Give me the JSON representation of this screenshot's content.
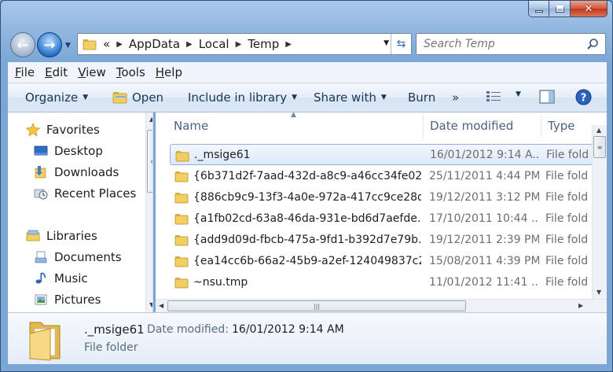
{
  "address": {
    "crumbs": [
      "«",
      "AppData",
      "Local",
      "Temp"
    ]
  },
  "search": {
    "placeholder": "Search Temp"
  },
  "menu": {
    "items": [
      {
        "key": "F",
        "rest": "ile"
      },
      {
        "key": "E",
        "rest": "dit"
      },
      {
        "key": "V",
        "rest": "iew"
      },
      {
        "key": "T",
        "rest": "ools"
      },
      {
        "key": "H",
        "rest": "elp"
      }
    ]
  },
  "toolbar": {
    "organize": "Organize",
    "open": "Open",
    "include": "Include in library",
    "share": "Share with",
    "burn": "Burn",
    "more": "»"
  },
  "nav": {
    "favorites": "Favorites",
    "desktop": "Desktop",
    "downloads": "Downloads",
    "recent": "Recent Places",
    "libraries": "Libraries",
    "documents": "Documents",
    "music": "Music",
    "pictures": "Pictures"
  },
  "columns": {
    "name": "Name",
    "date": "Date modified",
    "type": "Type"
  },
  "files": [
    {
      "name": "._msige61",
      "date": "16/01/2012 9:14 A...",
      "type": "File fold"
    },
    {
      "name": "{6b371d2f-7aad-432d-a8c9-a46cc34fe02...",
      "date": "25/11/2011 4:44 PM",
      "type": "File fold"
    },
    {
      "name": "{886cb9c9-13f3-4a0e-972a-417cc9ce28d...",
      "date": "19/12/2011 3:12 PM",
      "type": "File fold"
    },
    {
      "name": "{a1fb02cd-63a8-46da-931e-bd6d7aefde...",
      "date": "17/10/2011 10:44 ...",
      "type": "File fold"
    },
    {
      "name": "{add9d09d-fbcb-475a-9fd1-b392d7e79b...",
      "date": "19/12/2011 2:39 PM",
      "type": "File fold"
    },
    {
      "name": "{ea14cc6b-66a2-45b9-a2ef-124049837c2...",
      "date": "15/08/2011 4:39 PM",
      "type": "File fold"
    },
    {
      "name": "~nsu.tmp",
      "date": "11/01/2012 11:41 ...",
      "type": "File fold"
    }
  ],
  "details": {
    "name": "._msige61",
    "label": "Date modified:",
    "value": "16/01/2012 9:14 AM",
    "type": "File folder"
  },
  "colors": {
    "accent": "#3a6cb0",
    "selection": "#dce9f8"
  }
}
